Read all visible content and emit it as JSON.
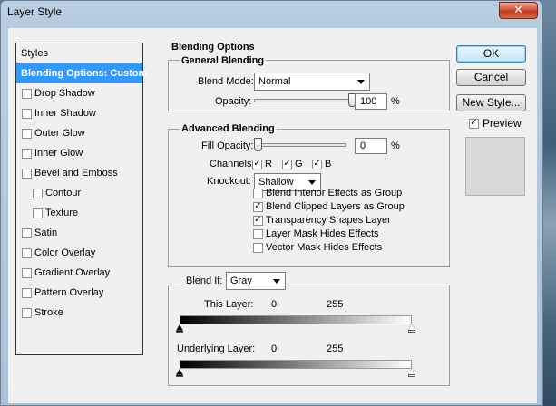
{
  "window": {
    "title": "Layer Style",
    "close_glyph": "✕"
  },
  "styles_list": {
    "header": "Styles",
    "items": [
      {
        "label": "Blending Options: Custom",
        "selected": true,
        "has_checkbox": false,
        "indent": false
      },
      {
        "label": "Drop Shadow",
        "checked": false,
        "indent": false
      },
      {
        "label": "Inner Shadow",
        "checked": false,
        "indent": false
      },
      {
        "label": "Outer Glow",
        "checked": false,
        "indent": false
      },
      {
        "label": "Inner Glow",
        "checked": false,
        "indent": false
      },
      {
        "label": "Bevel and Emboss",
        "checked": false,
        "indent": false
      },
      {
        "label": "Contour",
        "checked": false,
        "indent": true
      },
      {
        "label": "Texture",
        "checked": false,
        "indent": true
      },
      {
        "label": "Satin",
        "checked": false,
        "indent": false
      },
      {
        "label": "Color Overlay",
        "checked": false,
        "indent": false
      },
      {
        "label": "Gradient Overlay",
        "checked": false,
        "indent": false
      },
      {
        "label": "Pattern Overlay",
        "checked": false,
        "indent": false
      },
      {
        "label": "Stroke",
        "checked": false,
        "indent": false
      }
    ]
  },
  "blending_options": {
    "title": "Blending Options",
    "general": {
      "title": "General Blending",
      "blend_mode_label": "Blend Mode:",
      "blend_mode_value": "Normal",
      "opacity_label": "Opacity:",
      "opacity_value": "100",
      "opacity_unit": "%",
      "opacity_level": 1.0
    },
    "advanced": {
      "title": "Advanced Blending",
      "fill_opacity_label": "Fill Opacity:",
      "fill_opacity_value": "0",
      "fill_opacity_unit": "%",
      "fill_opacity_level": 0.0,
      "channels_label": "Channels:",
      "channel_r": "R",
      "channel_g": "G",
      "channel_b": "B",
      "knockout_label": "Knockout:",
      "knockout_value": "Shallow",
      "options": [
        {
          "label": "Blend Interior Effects as Group",
          "checked": false
        },
        {
          "label": "Blend Clipped Layers as Group",
          "checked": true
        },
        {
          "label": "Transparency Shapes Layer",
          "checked": true
        },
        {
          "label": "Layer Mask Hides Effects",
          "checked": false
        },
        {
          "label": "Vector Mask Hides Effects",
          "checked": false
        }
      ]
    },
    "blend_if": {
      "label": "Blend If:",
      "value": "Gray",
      "this_layer_label": "This Layer:",
      "this_layer_min": "0",
      "this_layer_max": "255",
      "underlying_label": "Underlying Layer:",
      "underlying_min": "0",
      "underlying_max": "255"
    }
  },
  "buttons": {
    "ok": "OK",
    "cancel": "Cancel",
    "new_style": "New Style..."
  },
  "preview": {
    "label": "Preview",
    "checked": true
  },
  "check_glyph": "✓",
  "colors": {
    "selection": "#3399ff",
    "dialog_bg": "#f0f0f0",
    "preview_swatch": "#d9d9d9"
  }
}
